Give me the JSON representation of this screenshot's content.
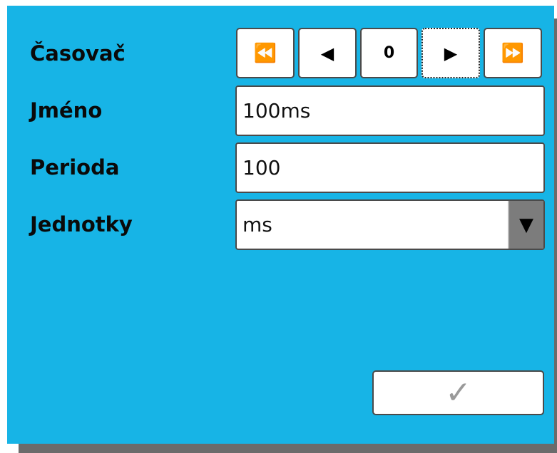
{
  "labels": {
    "timer": "Časovač",
    "name": "Jméno",
    "period": "Perioda",
    "units": "Jednotky"
  },
  "timer_nav": {
    "first": "⏪",
    "prev": "◀",
    "index": "0",
    "next": "▶",
    "last": "⏩"
  },
  "fields": {
    "name_value": "100ms",
    "period_value": "100",
    "units_selected": "ms"
  },
  "icons": {
    "dropdown": "▼",
    "confirm": "✓"
  },
  "colors": {
    "panel": "#17b4e6",
    "confirm_icon": "#9a9a9a"
  }
}
